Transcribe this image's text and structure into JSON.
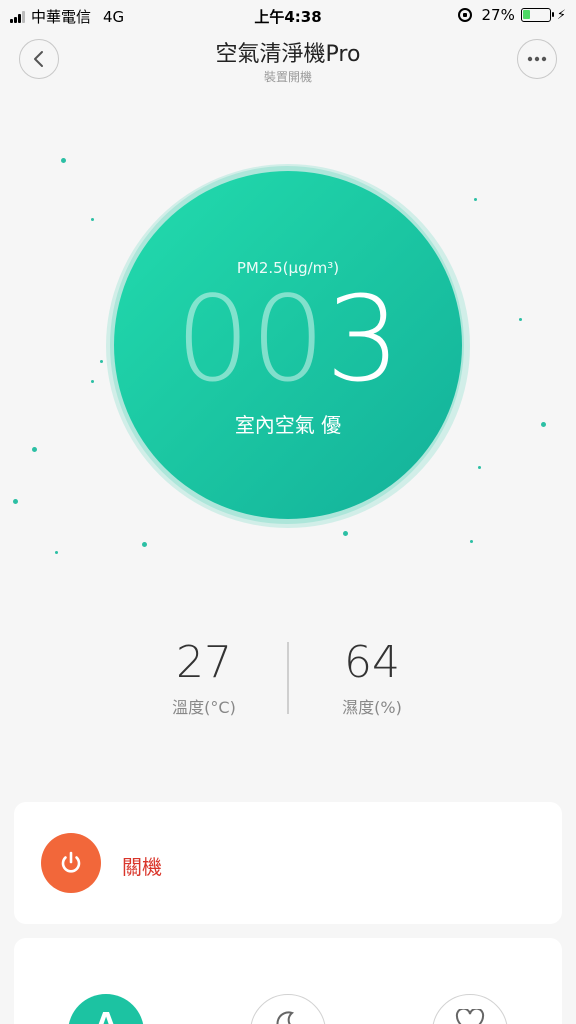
{
  "status_bar": {
    "carrier": "中華電信",
    "network": "4G",
    "time": "上午4:38",
    "battery_percent": "27%",
    "battery_level": 0.27
  },
  "header": {
    "title": "空氣清淨機Pro",
    "subtitle": "裝置開機",
    "back_icon": "chevron-left-icon",
    "more_icon": "more-dots-icon"
  },
  "aqi": {
    "label": "PM2.5(μg/m³)",
    "digits_dim": "00",
    "digits_lit": "3",
    "quality_text": "室內空氣 優"
  },
  "readings": {
    "temperature": {
      "value": "27",
      "label": "溫度(°C)"
    },
    "humidity": {
      "value": "64",
      "label": "濕度(%)"
    }
  },
  "power": {
    "label": "關機",
    "icon": "power-icon"
  },
  "modes": {
    "auto_icon": "A",
    "sleep_icon": "moon-icon",
    "favorite_icon": "heart-icon"
  },
  "colors": {
    "accent": "#1cc3a2",
    "power": "#f2673a",
    "power_text": "#d9352a",
    "background": "#f6f6f6"
  }
}
